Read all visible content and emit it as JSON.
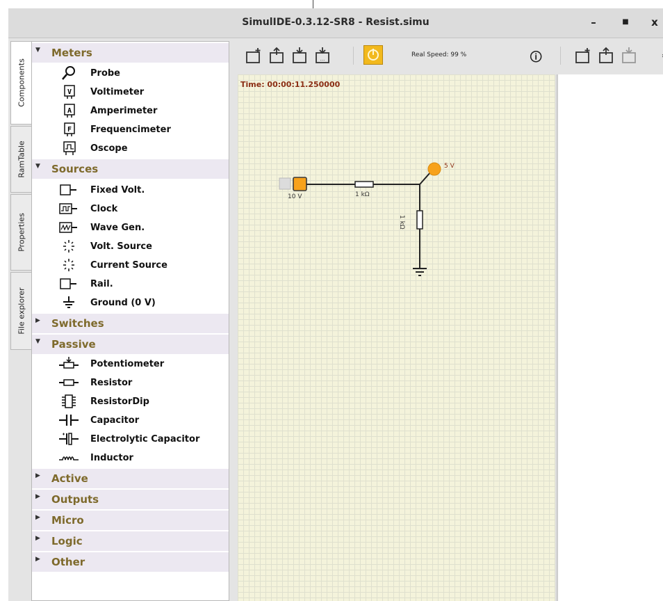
{
  "window": {
    "title": "SimulIDE-0.3.12-SR8  -  Resist.simu",
    "minimize": "–",
    "maximize": "■",
    "close": "x"
  },
  "tabs": [
    "Components",
    "RamTable",
    "Properties",
    "File explorer"
  ],
  "components": {
    "meters": {
      "label": "Meters",
      "items": [
        "Probe",
        "Voltimeter",
        "Amperimeter",
        "Frequencimeter",
        "Oscope"
      ]
    },
    "sources": {
      "label": "Sources",
      "items": [
        "Fixed Volt.",
        "Clock",
        "Wave Gen.",
        "Volt. Source",
        "Current Source",
        "Rail.",
        "Ground (0 V)"
      ]
    },
    "switches": {
      "label": "Switches"
    },
    "passive": {
      "label": "Passive",
      "items": [
        "Potentiometer",
        "Resistor",
        "ResistorDip",
        "Capacitor",
        "Electrolytic Capacitor",
        "Inductor"
      ]
    },
    "collapsed": [
      "Active",
      "Outputs",
      "Micro",
      "Logic",
      "Other"
    ]
  },
  "toolbar": {
    "real_speed": "Real Speed: 99 %",
    "more": "»",
    "info": "🛈"
  },
  "canvas": {
    "time": "Time: 00:00:11.250000",
    "source_label": "10 V",
    "resistor1_label": "1 kΩ",
    "resistor2_label": "1 kΩ",
    "probe_label": "5 V"
  },
  "colors": {
    "accent": "#f2b91d",
    "category_text": "#7e6a2c",
    "category_bg": "#ece8f1",
    "canvas_bg": "#f4f3db"
  }
}
